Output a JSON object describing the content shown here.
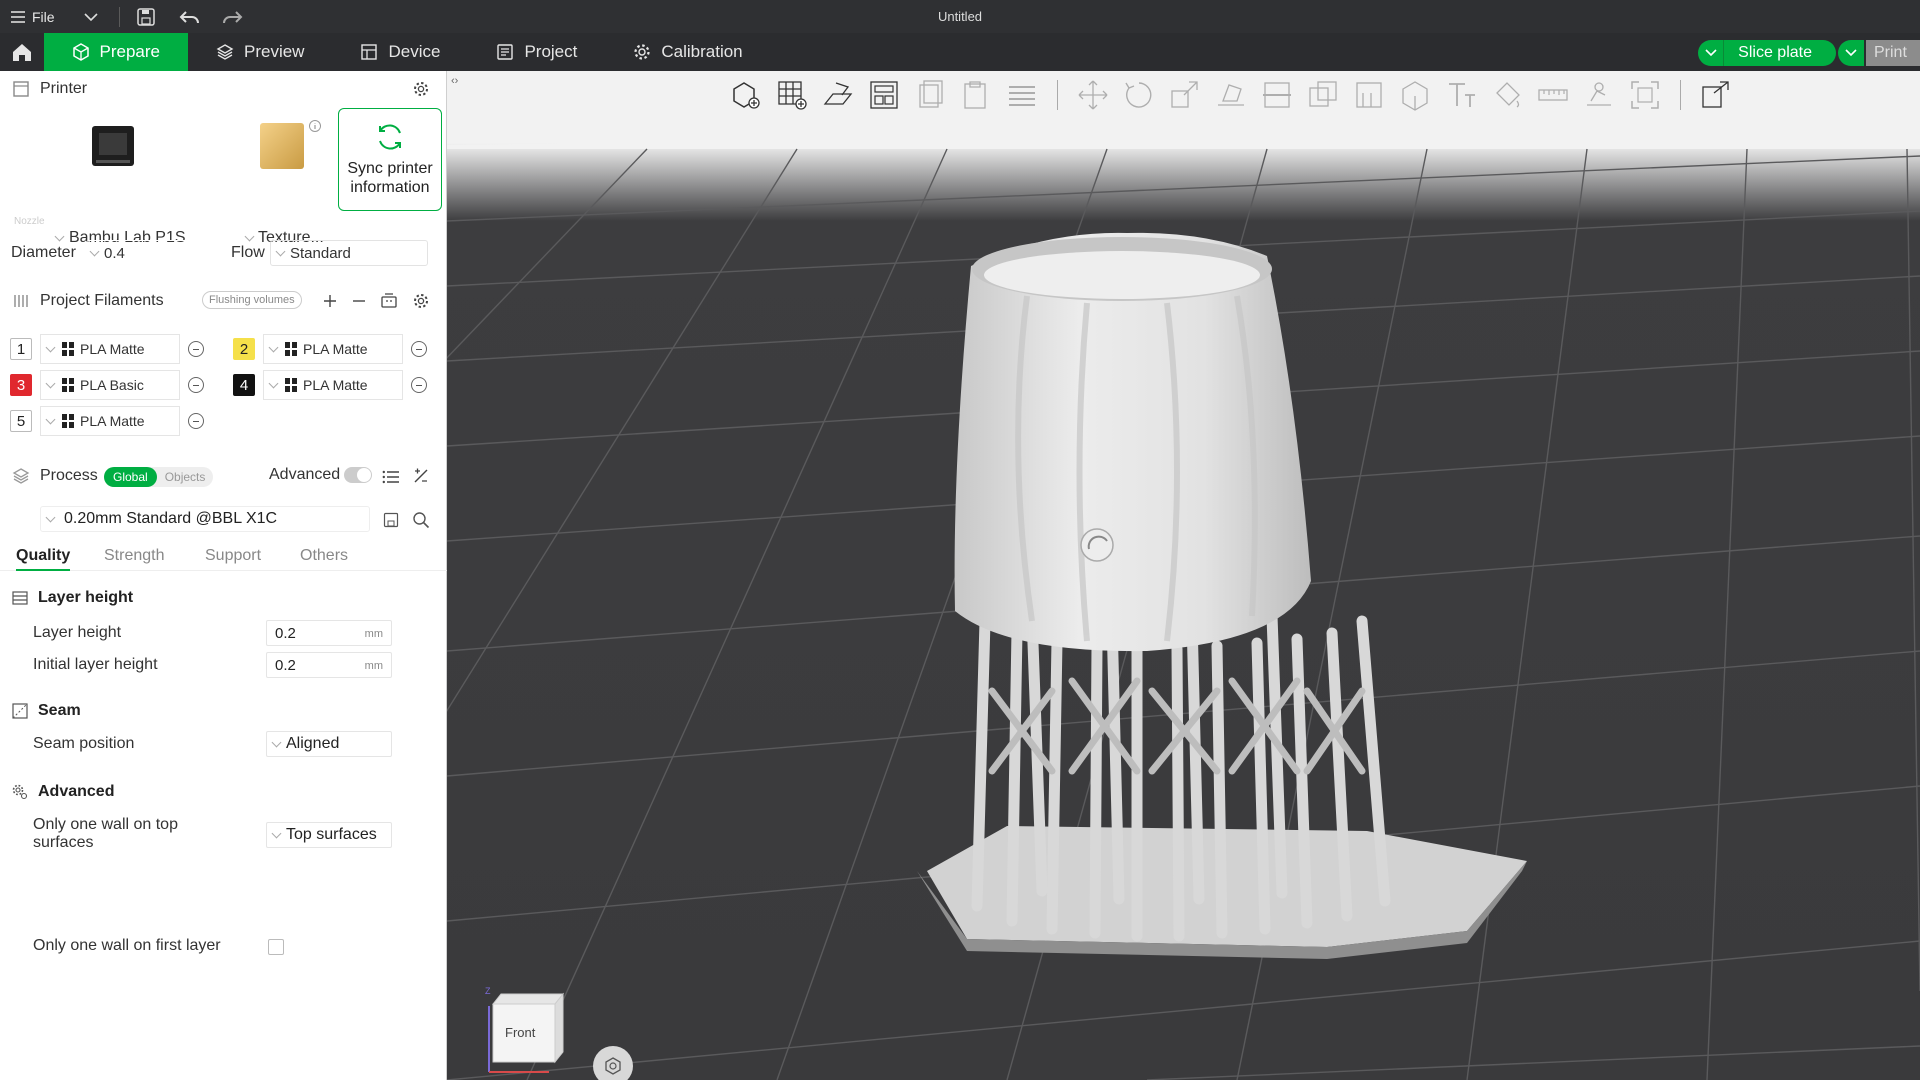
{
  "titlebar": {
    "file_label": "File",
    "title": "Untitled"
  },
  "tabs": [
    {
      "label": "Prepare",
      "active": true
    },
    {
      "label": "Preview"
    },
    {
      "label": "Device"
    },
    {
      "label": "Project"
    },
    {
      "label": "Calibration"
    }
  ],
  "actions": {
    "slice_label": "Slice plate",
    "print_label": "Print"
  },
  "printer": {
    "section_title": "Printer",
    "model": "Bambu Lab P1S",
    "plate": "Texture...",
    "sync_line1": "Sync printer",
    "sync_line2": "information",
    "nozzle_label": "Nozzle",
    "diameter_label": "Diameter",
    "diameter_value": "0.4",
    "flow_label": "Flow",
    "flow_value": "Standard"
  },
  "filaments": {
    "section_title": "Project Filaments",
    "flushing_label": "Flushing volumes",
    "items": [
      {
        "num": "1",
        "name": "PLA Matte",
        "color": "#ffffff",
        "text": "#222222"
      },
      {
        "num": "2",
        "name": "PLA Matte",
        "color": "#f5e04a",
        "text": "#222222"
      },
      {
        "num": "3",
        "name": "PLA Basic",
        "color": "#e0282e",
        "text": "#ffffff"
      },
      {
        "num": "4",
        "name": "PLA Matte",
        "color": "#111111",
        "text": "#ffffff"
      },
      {
        "num": "5",
        "name": "PLA Matte",
        "color": "#ffffff",
        "text": "#222222"
      }
    ]
  },
  "process": {
    "section_title": "Process",
    "global_label": "Global",
    "objects_label": "Objects",
    "advanced_label": "Advanced",
    "advanced_on": false,
    "preset": "0.20mm Standard @BBL X1C",
    "tabs": [
      "Quality",
      "Strength",
      "Support",
      "Others"
    ],
    "layer_height_group": "Layer height",
    "layer_height_label": "Layer height",
    "layer_height_value": "0.2",
    "initial_layer_label": "Initial layer height",
    "initial_layer_value": "0.2",
    "unit": "mm",
    "seam_group": "Seam",
    "seam_position_label": "Seam position",
    "seam_position_value": "Aligned",
    "advanced_group": "Advanced",
    "one_wall_top_label_1": "Only one wall on top",
    "one_wall_top_label_2": "surfaces",
    "one_wall_top_value": "Top surfaces",
    "one_wall_first_label": "Only one wall on first layer",
    "one_wall_first_checked": false
  },
  "viewport": {
    "navcube_face": "Front",
    "axis_z": "Z"
  },
  "colors": {
    "accent": "#00ae42",
    "topbar": "#2f3033",
    "bed": "#3a3a3c",
    "model": "#d9d9d9"
  }
}
